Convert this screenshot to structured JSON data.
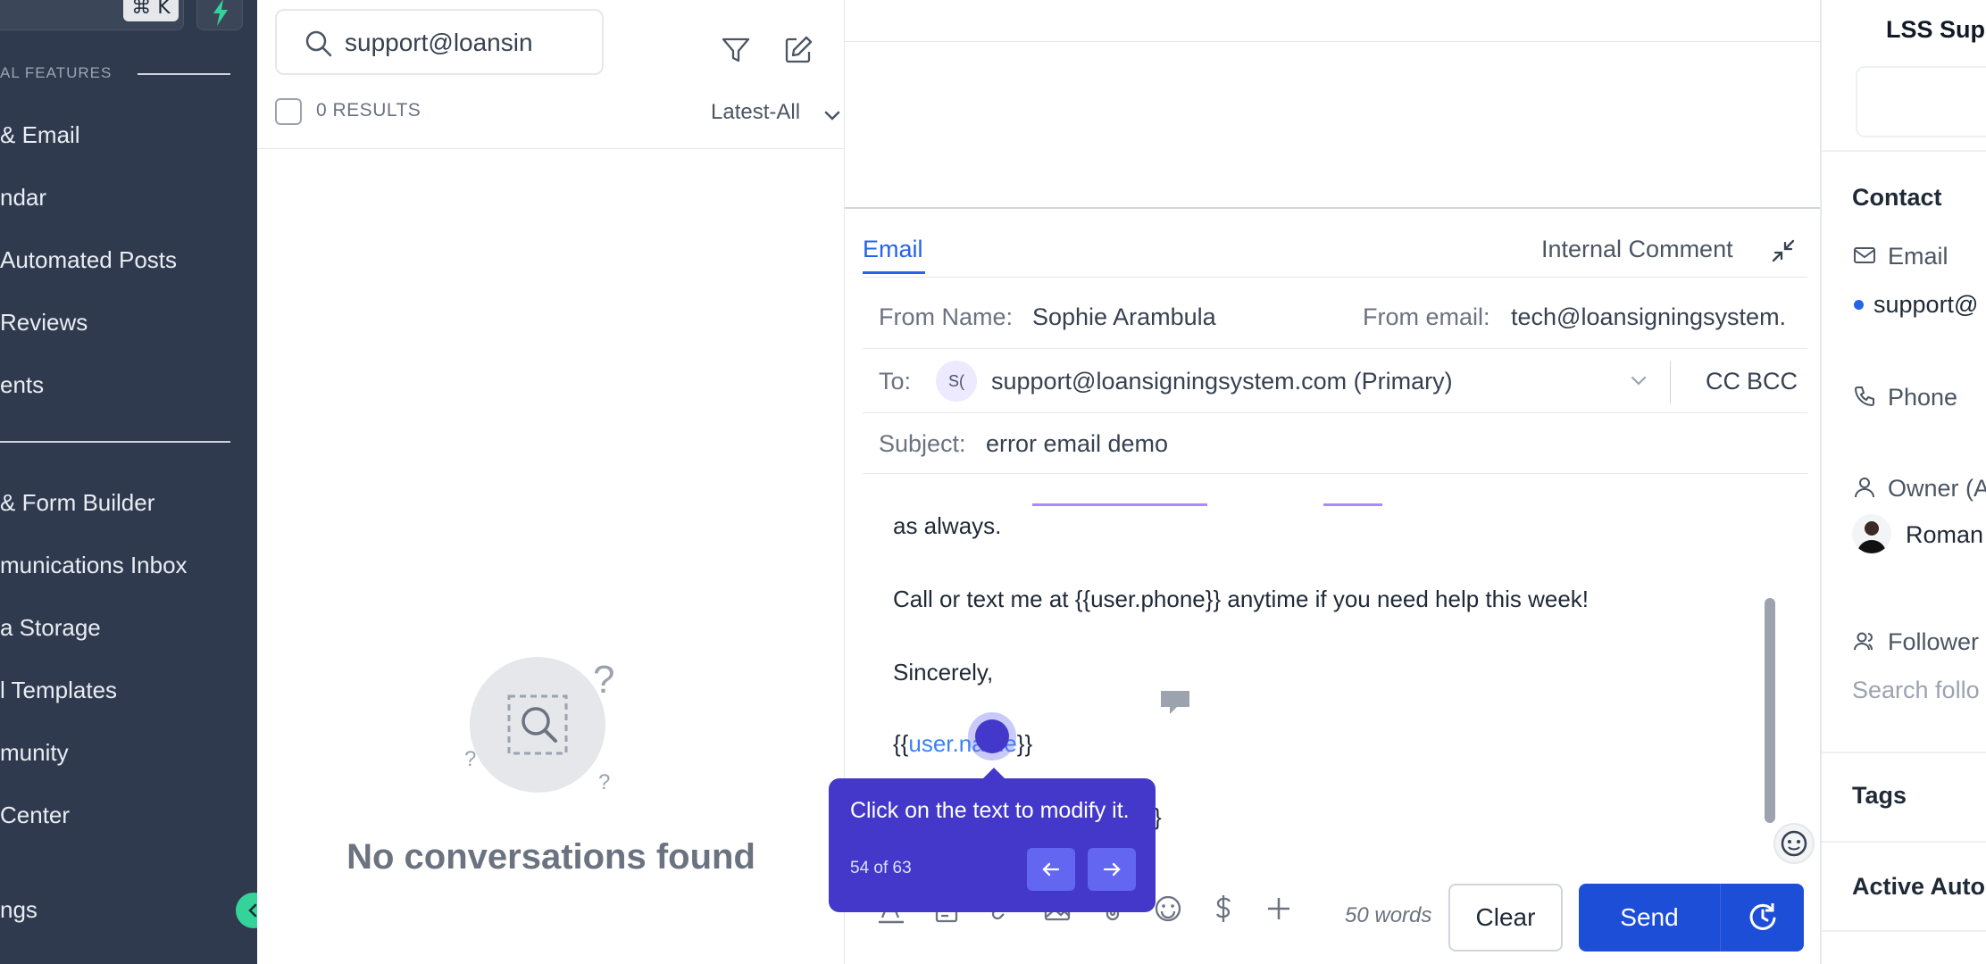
{
  "sidebar": {
    "kbd_hint": "⌘ K",
    "section_label": "AL FEATURES",
    "items": [
      {
        "label": "& Email"
      },
      {
        "label": "ndar"
      },
      {
        "label": "Automated Posts"
      },
      {
        "label": "Reviews"
      },
      {
        "label": "ents"
      },
      {
        "label": "& Form Builder"
      },
      {
        "label": "munications Inbox"
      },
      {
        "label": "a Storage"
      },
      {
        "label": "l Templates"
      },
      {
        "label": "munity"
      },
      {
        "label": "Center"
      },
      {
        "label": "ngs"
      }
    ]
  },
  "conversations": {
    "search_value": "support@loansin",
    "results_label": "0 RESULTS",
    "sort_label": "Latest-All",
    "empty_title": "No conversations found"
  },
  "compose": {
    "tab_email": "Email",
    "tab_internal": "Internal Comment",
    "from_name_label": "From Name:",
    "from_name_value": "Sophie Arambula",
    "from_email_label": "From email:",
    "from_email_value": "tech@loansigningsystem.",
    "to_label": "To:",
    "to_avatar": "S(",
    "to_value": "support@loansigningsystem.com (Primary)",
    "cc_label": "CC",
    "bcc_label": "BCC",
    "subject_label": "Subject:",
    "subject_value": "error email demo",
    "body_lines": {
      "line1": "as always.",
      "line2": "Call or text me at {{user.phone}} anytime if you need help this week!",
      "line3": "Sincerely,",
      "line4_open": "{{",
      "line4_var": "user.name",
      "line4_close": "}}",
      "line5_tail": "}"
    },
    "word_count": "50 words",
    "clear_label": "Clear",
    "send_label": "Send"
  },
  "tooltip": {
    "text": "Click on the text to modify it.",
    "step": "54 of 63"
  },
  "right_panel": {
    "title": "LSS Supp",
    "contact_heading": "Contact",
    "email_label": "Email",
    "email_value": "support@",
    "phone_label": "Phone",
    "owner_label": "Owner (A",
    "owner_value": "Roman",
    "followers_label": "Follower",
    "followers_placeholder": "Search follo",
    "tags_heading": "Tags",
    "active_heading": "Active Auto"
  },
  "colors": {
    "sidebar_bg": "#2f3a4e",
    "accent": "#2563eb",
    "tooltip_bg": "#4338ca",
    "send_bg": "#1d4ed8"
  }
}
